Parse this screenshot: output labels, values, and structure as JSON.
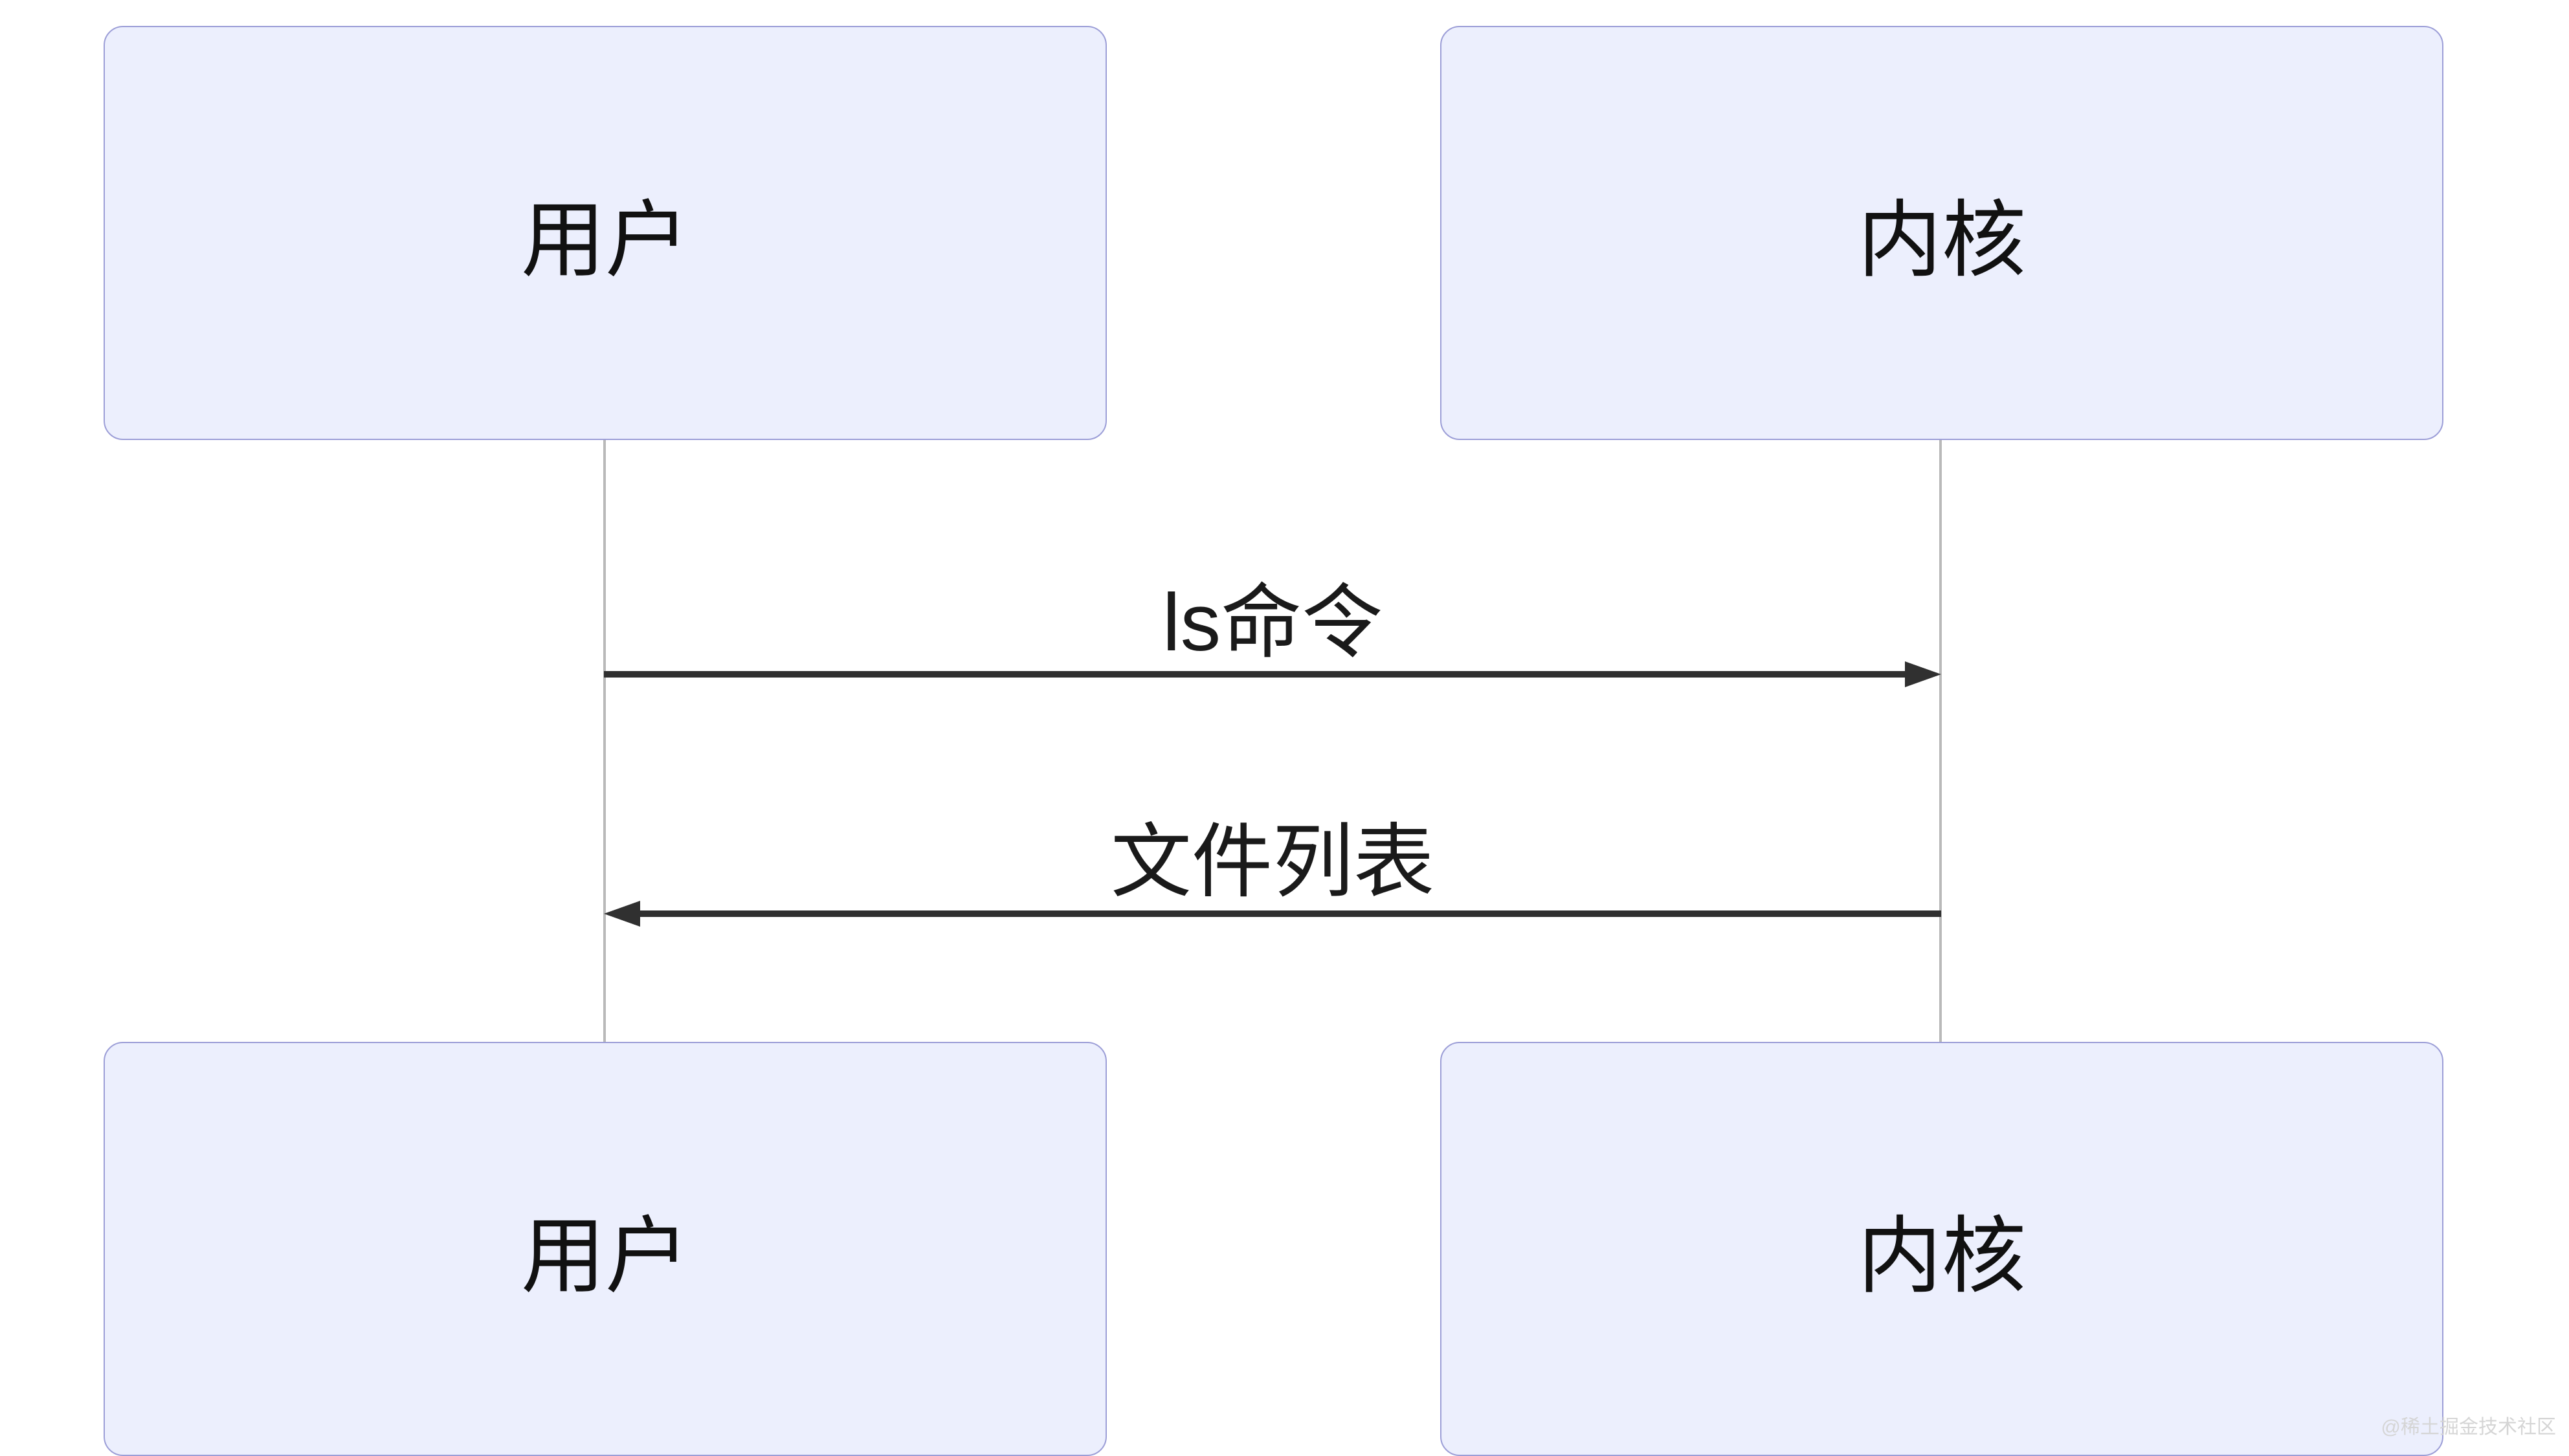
{
  "nodes": {
    "user_top": {
      "label": "用户"
    },
    "kernel_top": {
      "label": "内核"
    },
    "user_bot": {
      "label": "用户"
    },
    "kernel_bot": {
      "label": "内核"
    }
  },
  "messages": {
    "msg1": {
      "label": "ls命令",
      "direction": "right"
    },
    "msg2": {
      "label": "文件列表",
      "direction": "left"
    }
  },
  "colors": {
    "node_fill": "#eceffd",
    "node_border": "#9c9ed7",
    "arrow": "#303030",
    "lifeline": "#b9b9b9"
  },
  "watermark": "@稀土掘金技术社区"
}
